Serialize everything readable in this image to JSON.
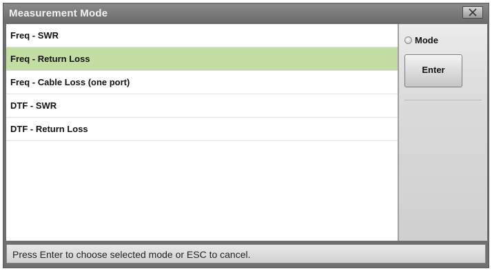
{
  "window": {
    "title": "Measurement Mode",
    "close_icon": "close-x-icon"
  },
  "list": {
    "selected_index": 1,
    "items": [
      {
        "label": "Freq - SWR"
      },
      {
        "label": "Freq - Return Loss"
      },
      {
        "label": "Freq - Cable Loss (one port)"
      },
      {
        "label": "DTF - SWR"
      },
      {
        "label": "DTF - Return Loss"
      }
    ]
  },
  "side": {
    "mode_label": "Mode",
    "enter_label": "Enter"
  },
  "status": {
    "text": "Press Enter to choose selected mode or ESC to cancel."
  },
  "colors": {
    "selected_row": "#c4dda2",
    "title_bar": "#7a7a7a"
  }
}
